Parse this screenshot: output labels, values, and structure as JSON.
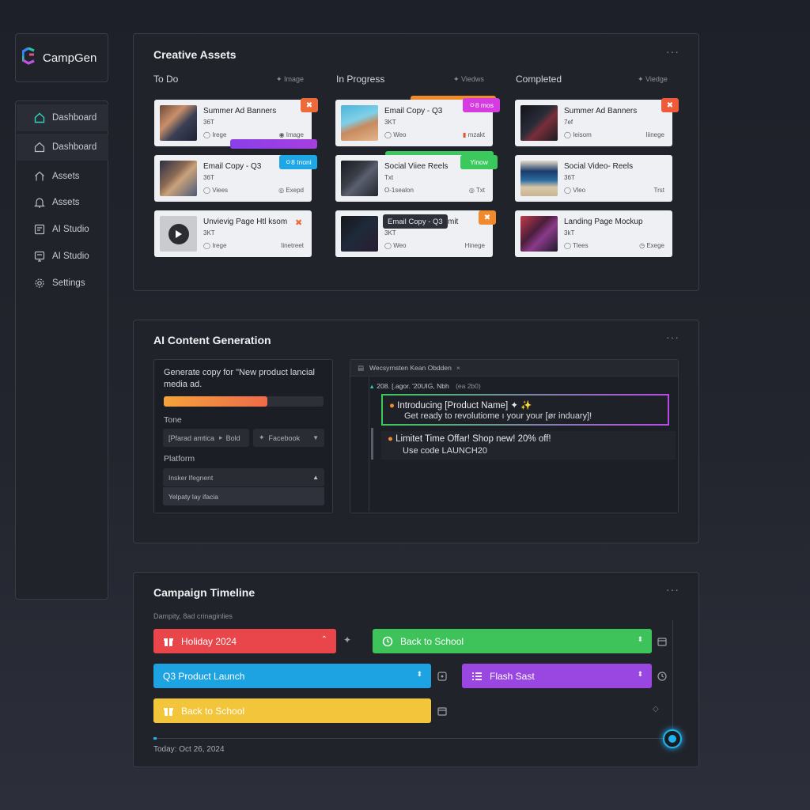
{
  "app": {
    "name": "CampGen"
  },
  "sidebar": {
    "items": [
      {
        "label": "Dashboard",
        "icon": "home-icon",
        "active": true
      },
      {
        "label": "Dashboard",
        "icon": "home-icon",
        "active": false
      },
      {
        "label": "Assets",
        "icon": "home-icon",
        "active": false
      },
      {
        "label": "Assets",
        "icon": "bell-icon",
        "active": false
      },
      {
        "label": "AI Studio",
        "icon": "ai-studio-icon",
        "active": false
      },
      {
        "label": "AI Studio",
        "icon": "ai-studio-icon",
        "active": false
      },
      {
        "label": "Settings",
        "icon": "gear-icon",
        "active": false
      }
    ]
  },
  "assets": {
    "title": "Creative Assets",
    "more": "···",
    "columns": [
      {
        "name": "To Do",
        "meta": "Image",
        "cards": [
          {
            "title": "Summer Ad Banners",
            "sub": "36T",
            "meta_left": "Irege",
            "meta_right": "Image",
            "badge": "✖",
            "badge_color": "#ef6a3a"
          },
          {
            "title": "Email Copy - Q3",
            "sub": "36T",
            "meta_left": "Viees",
            "meta_right": "Exepd",
            "tag": "ㅇ8  Inoni",
            "tag_color": "#1ea7e6"
          },
          {
            "title": "Unvievig Page Htl ksom",
            "sub": "3KT",
            "meta_left": "Irege",
            "meta_right": "Iinetreet",
            "badge": "✖",
            "badge_color": "transparent"
          }
        ]
      },
      {
        "name": "In Progress",
        "meta": "Viedws",
        "cards": [
          {
            "title": "Email Copy - Q3",
            "sub": "3KT",
            "meta_left": "Weo",
            "meta_right": "mzakt",
            "tag": "ㅇ8  mos",
            "tag_color": "#d53be0"
          },
          {
            "title": "Social Viiee Reels",
            "sub": "Txt",
            "meta_left": "O-1sealon",
            "meta_right": "Txt",
            "tag": "Yinow",
            "tag_color": "#3bc95d"
          },
          {
            "title": "Email Copy - Q3",
            "title_suffix": "mit",
            "sub": "3KT",
            "meta_left": "Weo",
            "meta_right": "Hinege",
            "badge": "✖",
            "badge_color": "#f08a2c"
          }
        ]
      },
      {
        "name": "Completed",
        "meta": "Viedge",
        "cards": [
          {
            "title": "Summer Ad Banners",
            "sub": "7ef",
            "meta_left": "Ieisom",
            "meta_right": "Iiinege",
            "badge": "✖",
            "badge_color": "#ef5b3a"
          },
          {
            "title": "Social Video- Reels",
            "sub": "36T",
            "meta_left": "Vleo",
            "meta_right": "Trst"
          },
          {
            "title": "Landing Page Mockup",
            "sub": "3kT",
            "meta_left": "Tlees",
            "meta_right": "Exege"
          }
        ]
      }
    ]
  },
  "ai": {
    "title": "AI Content Generation",
    "more": "···",
    "prompt": "Generate copy for \"New product lancial media ad.",
    "progress": 0.65,
    "tone_label": "Tone",
    "tone_value": "[Pfarad amtica",
    "tone_value2": "Bold",
    "platform_select": "Facebook",
    "platform_label": "Platform",
    "platform_dropdown": "Insker Ifegnent",
    "platform_option": "Yelpaty lay ifacia",
    "output_tab": "Wecsyrnsten Kean Obdden",
    "output_path": "208. [.agor. '20UIG, Nbh",
    "output_path_meta": "(ea 2b0)",
    "outputs": [
      {
        "line1": "Introducing [Product Name] ✦ ✨",
        "line2": "Get ready to revolutiome  ı your your [ør induary]!",
        "highlight": true
      },
      {
        "line1": "Limitet Time Offar! Shop new! 20% off!",
        "line2": "Use code LAUNCH20",
        "highlight": false
      }
    ]
  },
  "timeline": {
    "title": "Campaign Timeline",
    "more": "···",
    "subtitle": "Dampity, 8ad crinaginlies",
    "bars": [
      {
        "label": "Holiday 2024",
        "color": "#e9464b",
        "chevron": "⌃",
        "icon": "gift-icon"
      },
      {
        "label": "Back to School",
        "color": "#3ec25a",
        "chevron": "⌃",
        "icon": "refresh-icon"
      },
      {
        "label": "Q3 Product Launch",
        "prefix": "Q3",
        "color": "#1ea3e2",
        "chevron": "⌄",
        "icon": ""
      },
      {
        "label": "Flash Sast",
        "color": "#9a46e0",
        "chevron": "⌄",
        "icon": "list-icon"
      },
      {
        "label": "Back to School",
        "color": "#f2c53a",
        "chevron": "",
        "icon": "gift-icon"
      }
    ],
    "today": "Today: Oct 26, 2024"
  },
  "colors": {
    "accent_cyan": "#1fb4f0",
    "panel_bg": "#21232b",
    "border": "#3a3d47"
  }
}
